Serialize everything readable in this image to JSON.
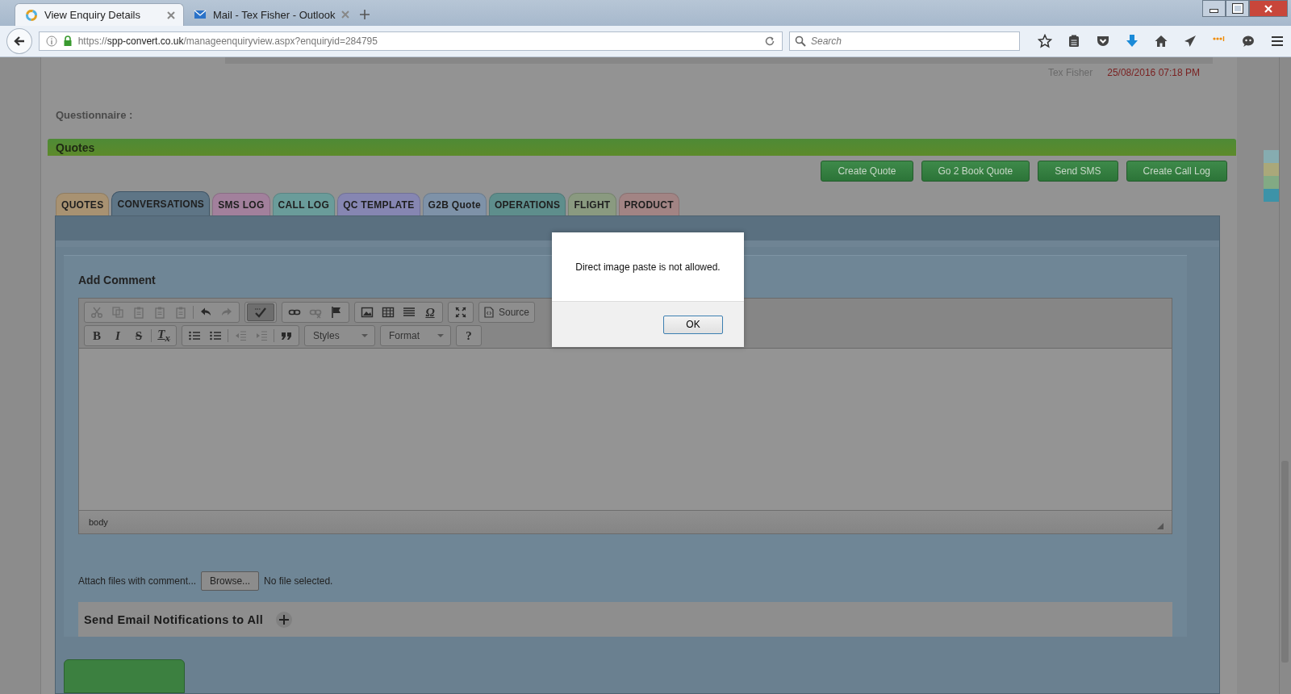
{
  "browser": {
    "tabs": [
      {
        "title": "View Enquiry Details",
        "selected": true
      },
      {
        "title": "Mail - Tex Fisher - Outlook",
        "selected": false
      }
    ],
    "url": {
      "scheme": "https://",
      "host": "spp-convert.co.uk",
      "path": "/manageenquiryview.aspx?enquiryid=284795"
    },
    "search": {
      "placeholder": "Search"
    }
  },
  "page": {
    "author": "Tex Fisher",
    "timestamp": "25/08/2016 07:18 PM",
    "questionnaire_label": "Questionnaire :",
    "quotes": {
      "title": "Quotes",
      "buttons": [
        "Create Quote",
        "Go 2 Book Quote",
        "Send SMS",
        "Create Call Log"
      ],
      "tabs": [
        {
          "label": "QUOTES",
          "color": "#a89272",
          "selected": false
        },
        {
          "label": "CONVERSATIONS",
          "color": "#5e7586",
          "selected": true
        },
        {
          "label": "SMS LOG",
          "color": "#a2809c",
          "selected": false
        },
        {
          "label": "CALL LOG",
          "color": "#6a9c9a",
          "selected": false
        },
        {
          "label": "QC TEMPLATE",
          "color": "#8686b2",
          "selected": false
        },
        {
          "label": "G2B Quote",
          "color": "#7e92a8",
          "selected": false
        },
        {
          "label": "OPERATIONS",
          "color": "#5e8e8c",
          "selected": false
        },
        {
          "label": "FLIGHT",
          "color": "#8a9a80",
          "selected": false
        },
        {
          "label": "PRODUCT",
          "color": "#a28484",
          "selected": false
        }
      ]
    },
    "comment": {
      "title": "Add Comment",
      "toolbar_rows": [
        [
          {
            "kind": "buttons",
            "items": [
              {
                "disabled": true
              },
              {
                "disabled": true
              },
              {
                "disabled": true
              },
              {
                "disabled": true
              },
              {
                "disabled": true
              },
              {
                "disabled": false
              },
              {
                "disabled": true
              }
            ]
          },
          {
            "kind": "buttons",
            "items": [
              {
                "disabled": false,
                "pressed": true
              }
            ]
          },
          {
            "kind": "buttons",
            "items": [
              {
                "disabled": false
              },
              {
                "disabled": true
              },
              {
                "disabled": false
              }
            ]
          },
          {
            "kind": "buttons",
            "items": [
              {
                "disabled": false
              },
              {
                "disabled": false
              },
              {
                "disabled": false
              },
              {
                "disabled": false,
                "glyph": "Ω"
              }
            ]
          },
          {
            "kind": "buttons",
            "items": [
              {
                "disabled": false
              }
            ]
          },
          {
            "kind": "source",
            "label": "Source"
          }
        ],
        [
          {
            "kind": "buttons",
            "items": [
              {
                "disabled": false,
                "glyph": "B"
              },
              {
                "disabled": false,
                "glyph": "I"
              },
              {
                "disabled": false,
                "glyph": "S"
              },
              {
                "disabled": false,
                "glyph": "T$_{x}$"
              }
            ]
          },
          {
            "kind": "buttons",
            "items": [
              {
                "disabled": false
              },
              {
                "disabled": false
              },
              {
                "disabled": true
              },
              {
                "disabled": true
              },
              {
                "disabled": false
              }
            ]
          },
          {
            "kind": "combo",
            "label": "Styles"
          },
          {
            "kind": "combo",
            "label": "Format"
          },
          {
            "kind": "buttons",
            "items": [
              {
                "disabled": false,
                "glyph": "?"
              }
            ]
          }
        ]
      ],
      "path_label": "body",
      "attach_label": "Attach files with comment...",
      "browse_button": "Browse...",
      "file_status": "No file selected.",
      "notify_label": "Send Email Notifications to All"
    },
    "side_swatches": [
      {
        "color": "#86acb0"
      },
      {
        "color": "#aaa87a"
      },
      {
        "color": "#82aa84"
      },
      {
        "color": "#3d93a8"
      }
    ]
  },
  "dialog": {
    "message": "Direct image paste is not allowed.",
    "button": "OK"
  }
}
